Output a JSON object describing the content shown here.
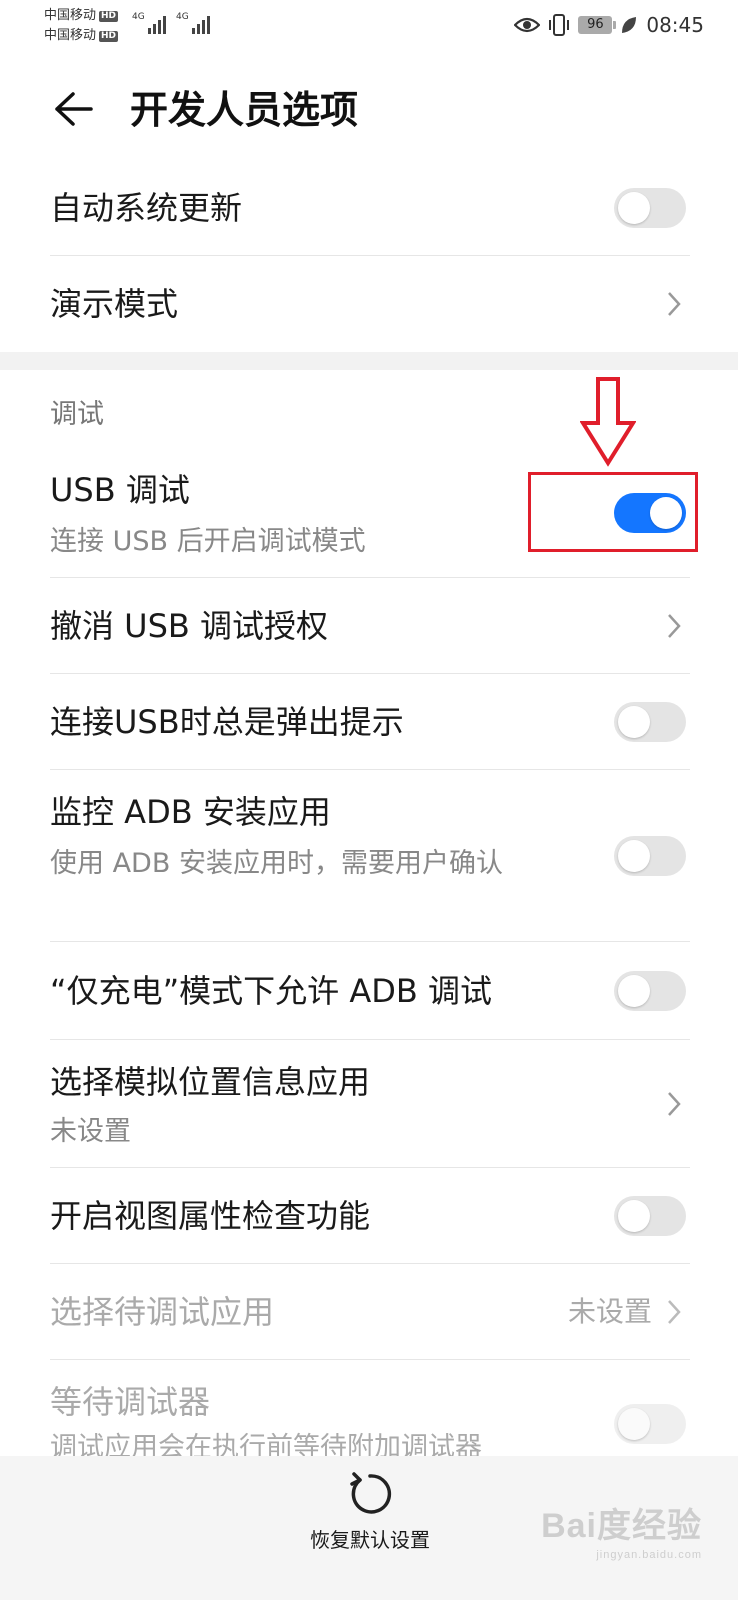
{
  "status_bar": {
    "carrier1": "中国移动",
    "carrier2": "中国移动",
    "hd": "HD",
    "network": "4G",
    "battery": "96",
    "time": "08:45"
  },
  "header": {
    "title": "开发人员选项"
  },
  "top_items": [
    {
      "label": "自动系统更新"
    },
    {
      "label": "演示模式"
    }
  ],
  "section": {
    "title": "调试",
    "usb_debug": {
      "label": "USB 调试",
      "summary": "连接 USB 后开启调试模式",
      "enabled": true
    },
    "revoke": {
      "label": "撤消 USB 调试授权"
    },
    "usb_prompt": {
      "label": "连接USB时总是弹出提示",
      "enabled": false
    },
    "adb_monitor": {
      "label": "监控 ADB 安装应用",
      "summary": "使用 ADB 安装应用时，需要用户确认",
      "enabled": false
    },
    "charge_only": {
      "label": "“仅充电”模式下允许 ADB 调试",
      "enabled": false
    },
    "mock_location": {
      "label": "选择模拟位置信息应用",
      "summary": "未设置"
    },
    "view_attr": {
      "label": "开启视图属性检查功能",
      "enabled": false
    },
    "debug_app": {
      "label": "选择待调试应用",
      "value": "未设置"
    },
    "wait_debugger": {
      "label": "等待调试器",
      "summary": "调试应用会在执行前等待附加调试器",
      "enabled": false
    }
  },
  "bottom": {
    "reset_label": "恢复默认设置"
  },
  "watermark": {
    "text": "Bai度经验",
    "sub": "jingyan.baidu.com"
  },
  "colors": {
    "accent": "#1476ff",
    "annotation": "#e01e2b"
  }
}
